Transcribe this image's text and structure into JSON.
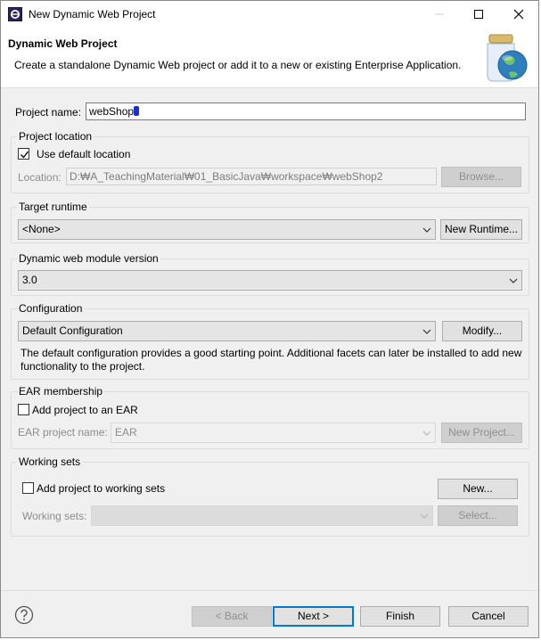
{
  "window": {
    "title": "New Dynamic Web Project",
    "controls": {
      "minimize": "minimize-icon",
      "maximize": "maximize-icon",
      "close": "close-icon"
    }
  },
  "header": {
    "title": "Dynamic Web Project",
    "description": "Create a standalone Dynamic Web project or add it to a new or existing Enterprise Application."
  },
  "project_name": {
    "label": "Project name:",
    "value": "webShop"
  },
  "project_location": {
    "group_title": "Project location",
    "use_default_label": "Use default location",
    "use_default_checked": true,
    "location_label": "Location:",
    "location_value": "D:₩A_TeachingMaterial₩01_BasicJava₩workspace₩webShop2",
    "browse_label": "Browse..."
  },
  "target_runtime": {
    "group_title": "Target runtime",
    "selected": "<None>",
    "new_runtime_label": "New Runtime..."
  },
  "module_version": {
    "group_title": "Dynamic web module version",
    "selected": "3.0"
  },
  "configuration": {
    "group_title": "Configuration",
    "selected": "Default Configuration",
    "modify_label": "Modify...",
    "description": "The default configuration provides a good starting point. Additional facets can later be installed to add new functionality to the project."
  },
  "ear": {
    "group_title": "EAR membership",
    "add_label": "Add project to an EAR",
    "add_checked": false,
    "project_name_label": "EAR project name:",
    "project_name_value": "EAR",
    "new_project_label": "New Project..."
  },
  "working_sets": {
    "group_title": "Working sets",
    "add_label": "Add project to working sets",
    "add_checked": false,
    "new_label": "New...",
    "working_sets_label": "Working sets:",
    "working_sets_value": "",
    "select_label": "Select..."
  },
  "footer": {
    "back_label": "< Back",
    "next_label": "Next >",
    "finish_label": "Finish",
    "cancel_label": "Cancel"
  },
  "colors": {
    "accent": "#0078d7",
    "caret": "#1a2fd6",
    "disabled_text": "#8c8c8c"
  }
}
